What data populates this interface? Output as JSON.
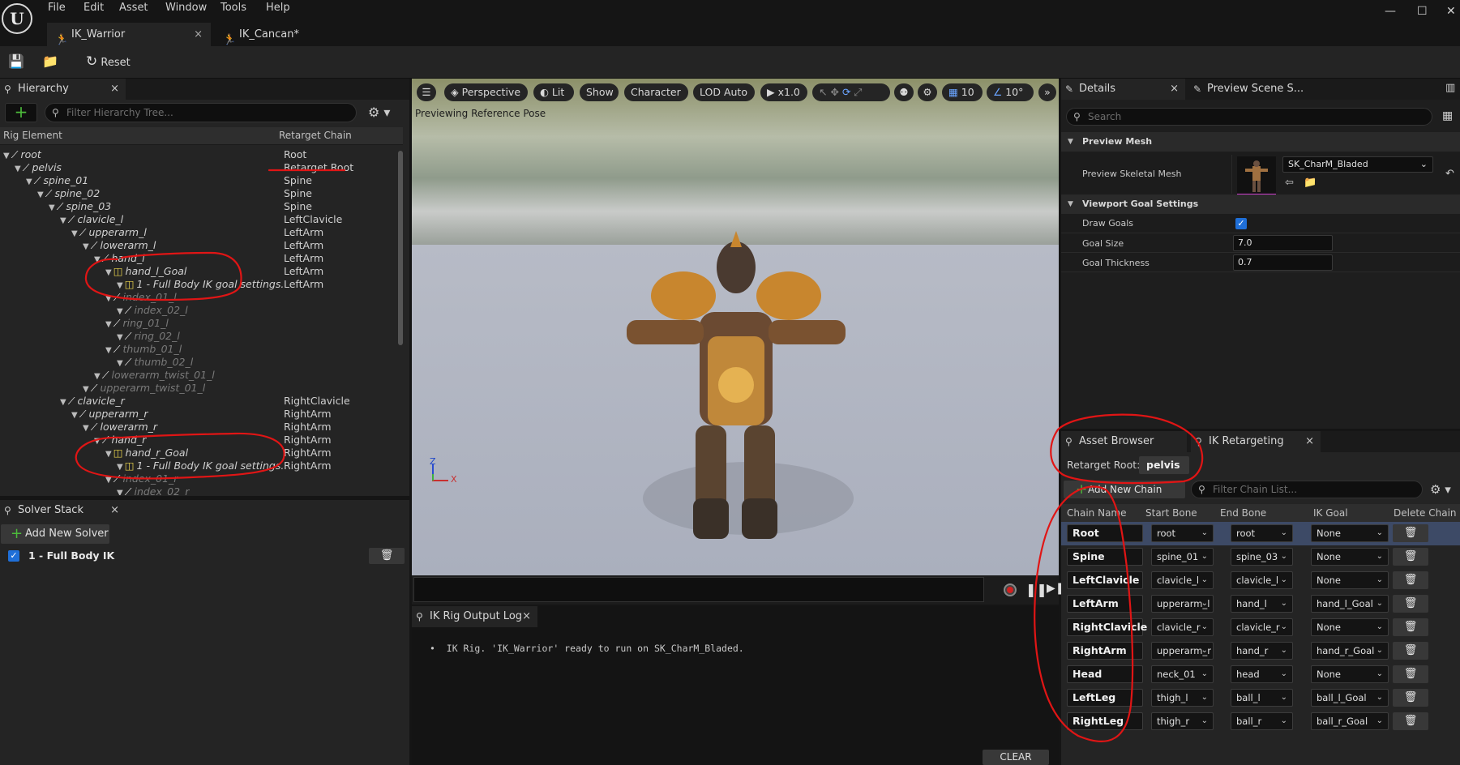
{
  "menu": {
    "items": [
      "File",
      "Edit",
      "Asset",
      "Window",
      "Tools",
      "Help"
    ]
  },
  "logo": "U",
  "tabs": [
    {
      "label": "IK_Warrior",
      "active": true,
      "close": "×"
    },
    {
      "label": "IK_Cancan*",
      "active": false
    }
  ],
  "toolbar": {
    "reset_label": "Reset"
  },
  "hierarchy": {
    "tab_label": "Hierarchy",
    "search_placeholder": "Filter Hierarchy Tree...",
    "col_element": "Rig Element",
    "col_chain": "Retarget Chain",
    "rows": [
      {
        "name": "root",
        "chain": "Root",
        "depth": 0,
        "type": "bone",
        "dim": false
      },
      {
        "name": "pelvis",
        "chain": "Retarget Root",
        "depth": 1,
        "type": "bone",
        "dim": false
      },
      {
        "name": "spine_01",
        "chain": "Spine",
        "depth": 2,
        "type": "bone",
        "dim": false
      },
      {
        "name": "spine_02",
        "chain": "Spine",
        "depth": 3,
        "type": "bone",
        "dim": false
      },
      {
        "name": "spine_03",
        "chain": "Spine",
        "depth": 4,
        "type": "bone",
        "dim": false
      },
      {
        "name": "clavicle_l",
        "chain": "LeftClavicle",
        "depth": 5,
        "type": "bone",
        "dim": false
      },
      {
        "name": "upperarm_l",
        "chain": "LeftArm",
        "depth": 6,
        "type": "bone",
        "dim": false
      },
      {
        "name": "lowerarm_l",
        "chain": "LeftArm",
        "depth": 7,
        "type": "bone",
        "dim": false
      },
      {
        "name": "hand_l",
        "chain": "LeftArm",
        "depth": 8,
        "type": "bone",
        "dim": false
      },
      {
        "name": "hand_l_Goal",
        "chain": "LeftArm",
        "depth": 9,
        "type": "goal",
        "dim": false
      },
      {
        "name": "1 - Full Body IK goal settings.",
        "chain": "LeftArm",
        "depth": 10,
        "type": "goal",
        "dim": false
      },
      {
        "name": "index_01_l",
        "chain": "",
        "depth": 9,
        "type": "bone",
        "dim": true
      },
      {
        "name": "index_02_l",
        "chain": "",
        "depth": 10,
        "type": "bone",
        "dim": true
      },
      {
        "name": "ring_01_l",
        "chain": "",
        "depth": 9,
        "type": "bone",
        "dim": true
      },
      {
        "name": "ring_02_l",
        "chain": "",
        "depth": 10,
        "type": "bone",
        "dim": true
      },
      {
        "name": "thumb_01_l",
        "chain": "",
        "depth": 9,
        "type": "bone",
        "dim": true
      },
      {
        "name": "thumb_02_l",
        "chain": "",
        "depth": 10,
        "type": "bone",
        "dim": true
      },
      {
        "name": "lowerarm_twist_01_l",
        "chain": "",
        "depth": 8,
        "type": "bone",
        "dim": true
      },
      {
        "name": "upperarm_twist_01_l",
        "chain": "",
        "depth": 7,
        "type": "bone",
        "dim": true
      },
      {
        "name": "clavicle_r",
        "chain": "RightClavicle",
        "depth": 5,
        "type": "bone",
        "dim": false
      },
      {
        "name": "upperarm_r",
        "chain": "RightArm",
        "depth": 6,
        "type": "bone",
        "dim": false
      },
      {
        "name": "lowerarm_r",
        "chain": "RightArm",
        "depth": 7,
        "type": "bone",
        "dim": false
      },
      {
        "name": "hand_r",
        "chain": "RightArm",
        "depth": 8,
        "type": "bone",
        "dim": false
      },
      {
        "name": "hand_r_Goal",
        "chain": "RightArm",
        "depth": 9,
        "type": "goal",
        "dim": false
      },
      {
        "name": "1 - Full Body IK goal settings.",
        "chain": "RightArm",
        "depth": 10,
        "type": "goal",
        "dim": false
      },
      {
        "name": "index_01_r",
        "chain": "",
        "depth": 9,
        "type": "bone",
        "dim": true
      },
      {
        "name": "index_02_r",
        "chain": "",
        "depth": 10,
        "type": "bone",
        "dim": true
      }
    ]
  },
  "solver_stack": {
    "tab_label": "Solver Stack",
    "add_label": "Add New Solver",
    "solvers": [
      {
        "label": "1 - Full Body IK",
        "enabled": true
      }
    ]
  },
  "viewport": {
    "buttons": [
      "Perspective",
      "Lit",
      "Show",
      "Character",
      "LOD Auto",
      "x1.0",
      "10",
      "10°"
    ],
    "overlay": "Previewing Reference Pose",
    "axis_z": "Z",
    "axis_x": "X"
  },
  "output_log": {
    "tab_label": "IK Rig Output Log",
    "lines": [
      "IK Rig. 'IK_Warrior' ready to run on SK_CharM_Bladed."
    ],
    "clear_label": "CLEAR"
  },
  "details": {
    "tab_label": "Details",
    "tab2_label": "Preview Scene S...",
    "search_placeholder": "Search",
    "preview_mesh_section": "Preview Mesh",
    "preview_skeletal_mesh_label": "Preview Skeletal Mesh",
    "mesh_value": "SK_CharM_Bladed",
    "goal_section": "Viewport Goal Settings",
    "draw_goals_label": "Draw Goals",
    "draw_goals": true,
    "goal_size_label": "Goal Size",
    "goal_size": "7.0",
    "goal_thickness_label": "Goal Thickness",
    "goal_thickness": "0.7"
  },
  "retarget": {
    "tab1": "Asset Browser",
    "tab2": "IK Retargeting",
    "root_label": "Retarget Root:",
    "root_value": "pelvis",
    "add_chain": "Add New Chain",
    "filter_placeholder": "Filter Chain List...",
    "columns": [
      "Chain Name",
      "Start Bone",
      "End Bone",
      "IK Goal",
      "Delete Chain"
    ],
    "chains": [
      {
        "name": "Root",
        "start": "root",
        "end": "root",
        "goal": "None"
      },
      {
        "name": "Spine",
        "start": "spine_01",
        "end": "spine_03",
        "goal": "None"
      },
      {
        "name": "LeftClavicle",
        "start": "clavicle_l",
        "end": "clavicle_l",
        "goal": "None"
      },
      {
        "name": "LeftArm",
        "start": "upperarm_l",
        "end": "hand_l",
        "goal": "hand_l_Goal"
      },
      {
        "name": "RightClavicle",
        "start": "clavicle_r",
        "end": "clavicle_r",
        "goal": "None"
      },
      {
        "name": "RightArm",
        "start": "upperarm_r",
        "end": "hand_r",
        "goal": "hand_r_Goal"
      },
      {
        "name": "Head",
        "start": "neck_01",
        "end": "head",
        "goal": "None"
      },
      {
        "name": "LeftLeg",
        "start": "thigh_l",
        "end": "ball_l",
        "goal": "ball_l_Goal"
      },
      {
        "name": "RightLeg",
        "start": "thigh_r",
        "end": "ball_r",
        "goal": "ball_r_Goal"
      }
    ]
  },
  "colors": {
    "accent_blue": "#1f6fd8",
    "annotation_red": "#e01515",
    "add_green": "#4cbb3b",
    "asset_yellow": "#e4a927"
  }
}
